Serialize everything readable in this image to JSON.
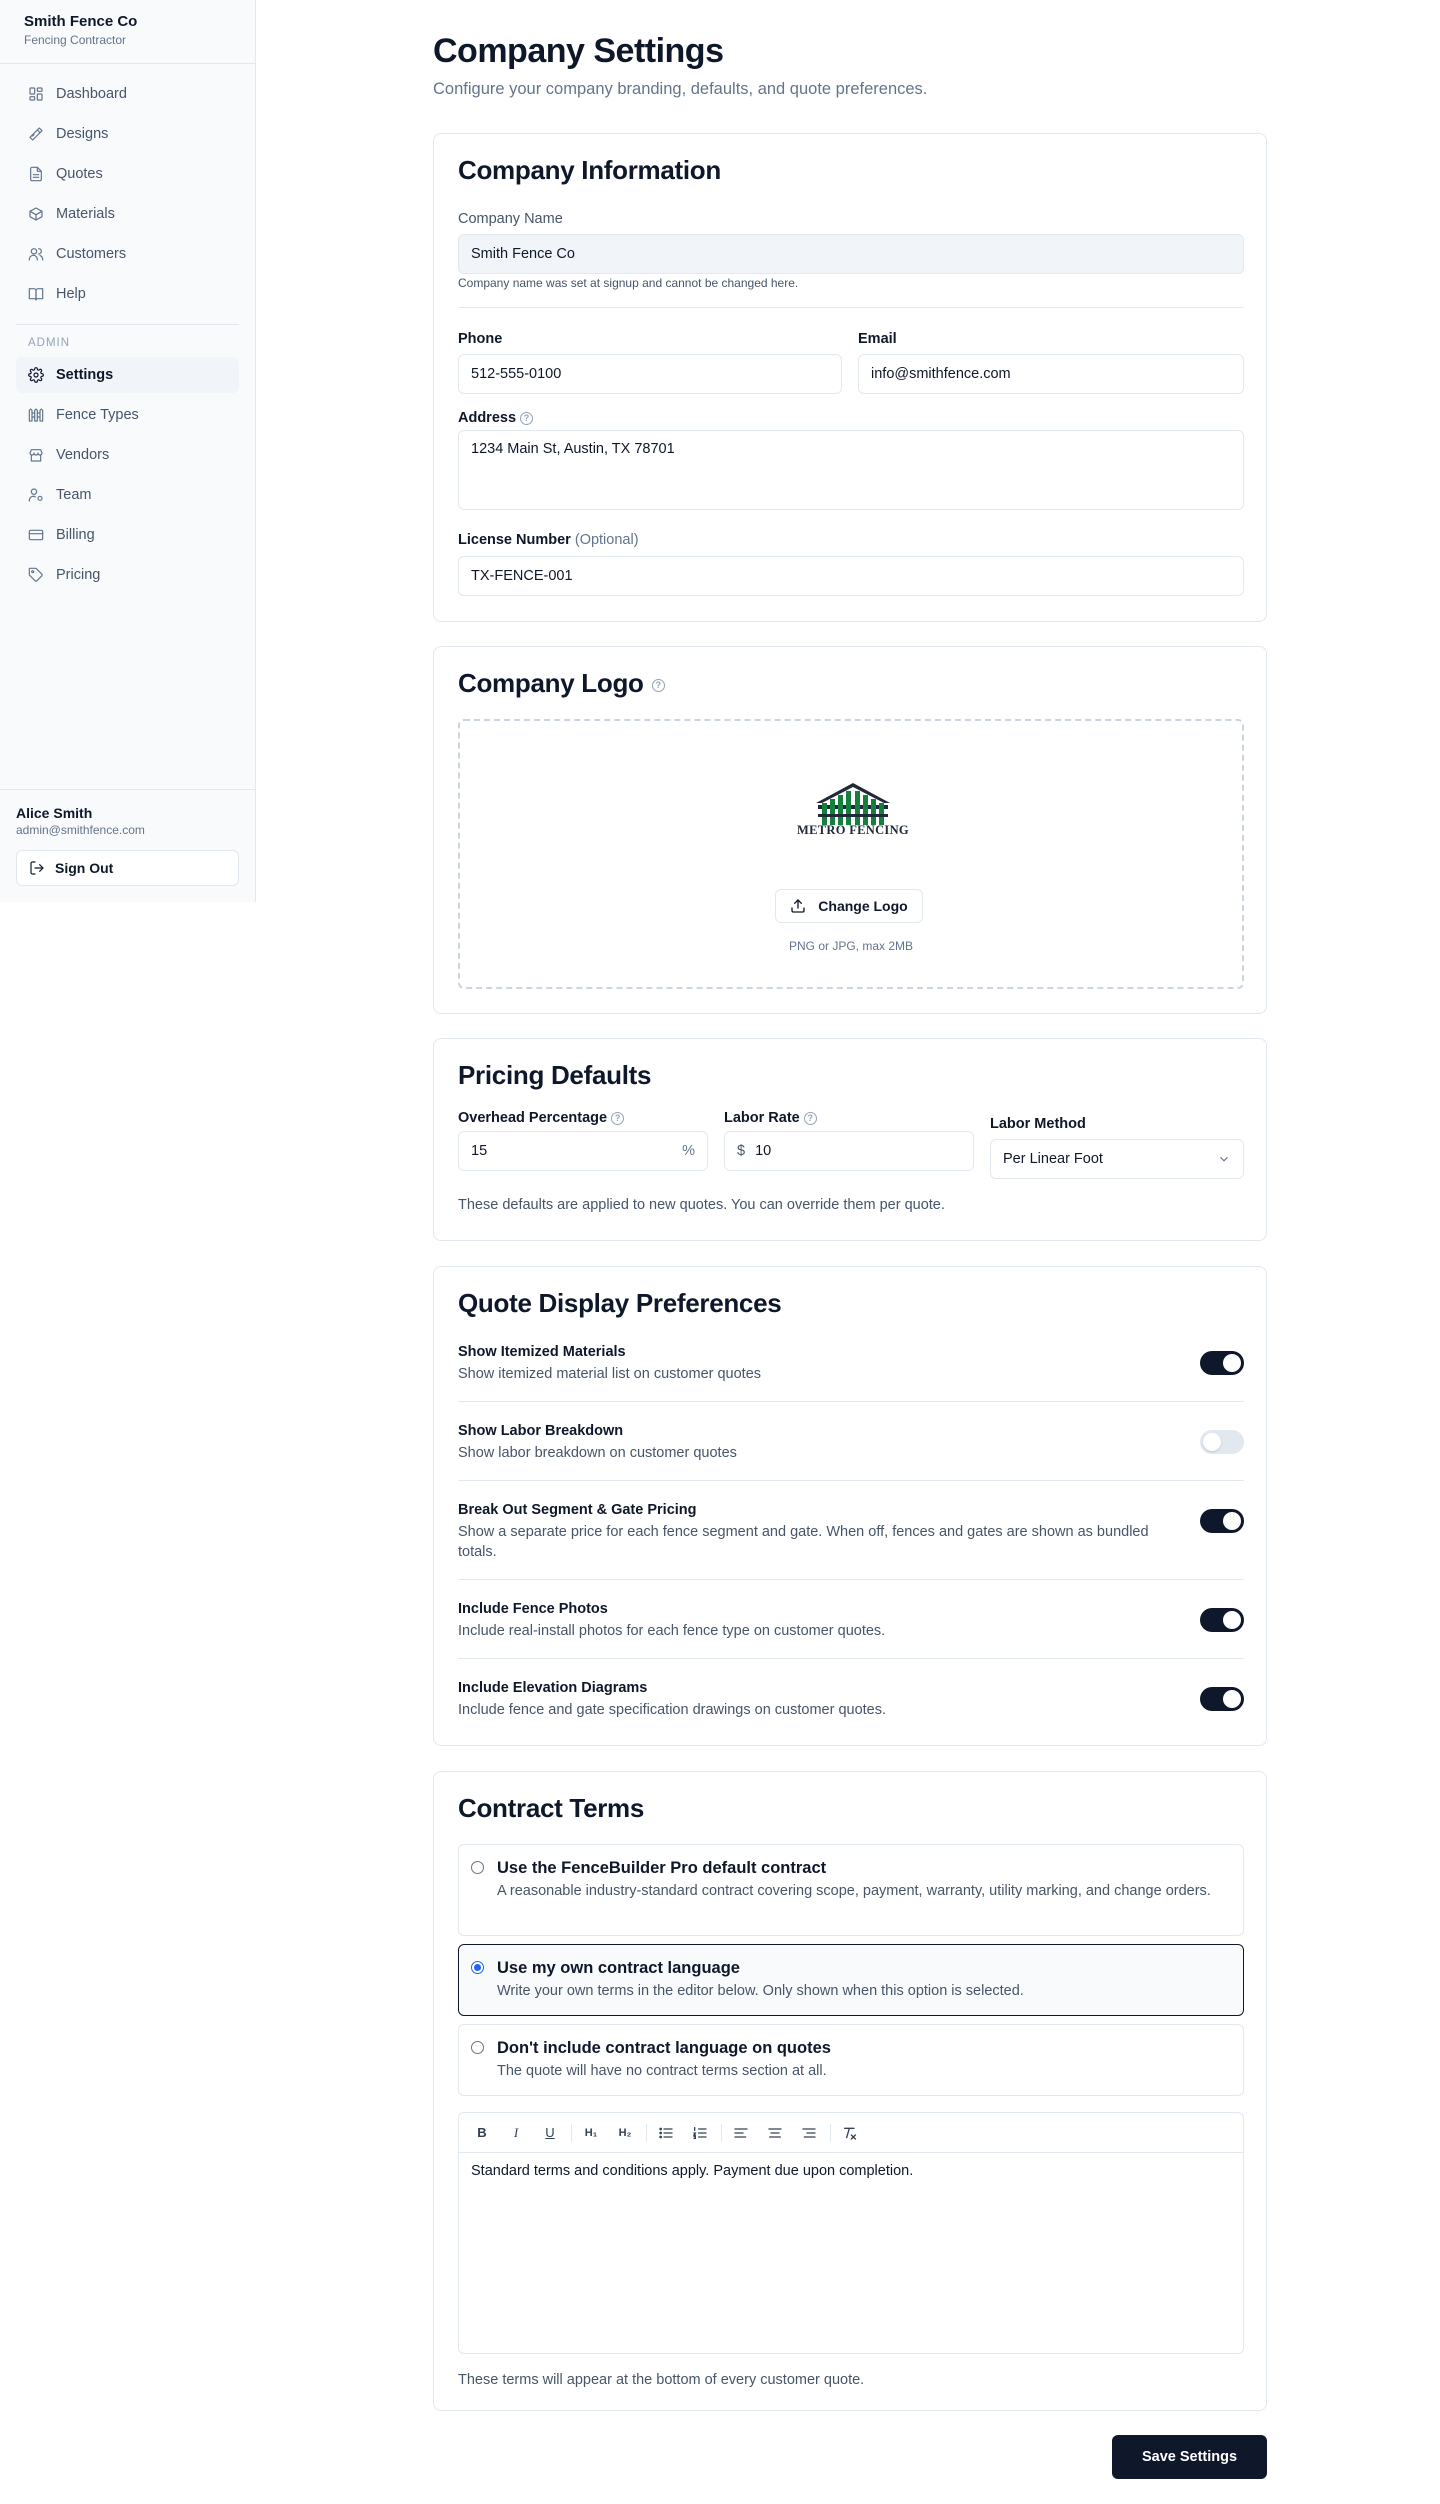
{
  "sidebar": {
    "company_name": "Smith Fence Co",
    "company_type": "Fencing Contractor",
    "items": [
      {
        "label": "Dashboard",
        "icon": "grid-icon"
      },
      {
        "label": "Designs",
        "icon": "pencil-ruler-icon"
      },
      {
        "label": "Quotes",
        "icon": "file-text-icon"
      },
      {
        "label": "Materials",
        "icon": "package-icon"
      },
      {
        "label": "Customers",
        "icon": "users-icon"
      },
      {
        "label": "Help",
        "icon": "book-icon"
      }
    ],
    "admin_section_label": "ADMIN",
    "admin_items": [
      {
        "label": "Settings",
        "icon": "gear-icon",
        "active": true
      },
      {
        "label": "Fence Types",
        "icon": "fence-icon"
      },
      {
        "label": "Vendors",
        "icon": "store-icon"
      },
      {
        "label": "Team",
        "icon": "user-cog-icon"
      },
      {
        "label": "Billing",
        "icon": "credit-card-icon"
      },
      {
        "label": "Pricing",
        "icon": "tag-icon"
      }
    ],
    "user_name": "Alice Smith",
    "user_email": "admin@smithfence.com",
    "sign_out_label": "Sign Out"
  },
  "header": {
    "title": "Company Settings",
    "subtitle": "Configure your company branding, defaults, and quote preferences."
  },
  "company_info": {
    "title": "Company Information",
    "company_name_label": "Company Name",
    "company_name_value": "Smith Fence Co",
    "company_name_hint": "Company name was set at signup and cannot be changed here.",
    "phone_label": "Phone",
    "phone_value": "512-555-0100",
    "email_label": "Email",
    "email_value": "info@smithfence.com",
    "address_label": "Address",
    "address_value": "1234 Main St, Austin, TX 78701",
    "license_label": "License Number",
    "license_optional": "(Optional)",
    "license_value": "TX-FENCE-001"
  },
  "logo": {
    "title": "Company Logo",
    "logo_text": "METRO FENCING",
    "change_label": "Change Logo",
    "hint": "PNG or JPG, max 2MB"
  },
  "pricing": {
    "title": "Pricing Defaults",
    "overhead_label": "Overhead Percentage",
    "overhead_value": "15",
    "overhead_unit": "%",
    "labor_rate_label": "Labor Rate",
    "labor_rate_prefix": "$",
    "labor_rate_value": "10",
    "labor_method_label": "Labor Method",
    "labor_method_value": "Per Linear Foot",
    "hint": "These defaults are applied to new quotes. You can override them per quote."
  },
  "display": {
    "title": "Quote Display Preferences",
    "prefs": [
      {
        "title": "Show Itemized Materials",
        "desc": "Show itemized material list on customer quotes",
        "on": true
      },
      {
        "title": "Show Labor Breakdown",
        "desc": "Show labor breakdown on customer quotes",
        "on": false
      },
      {
        "title": "Break Out Segment & Gate Pricing",
        "desc": "Show a separate price for each fence segment and gate. When off, fences and gates are shown as bundled totals.",
        "on": true
      },
      {
        "title": "Include Fence Photos",
        "desc": "Include real-install photos for each fence type on customer quotes.",
        "on": true
      },
      {
        "title": "Include Elevation Diagrams",
        "desc": "Include fence and gate specification drawings on customer quotes.",
        "on": true
      }
    ]
  },
  "contract": {
    "title": "Contract Terms",
    "options": [
      {
        "title": "Use the FenceBuilder Pro default contract",
        "desc": "A reasonable industry-standard contract covering scope, payment, warranty, utility marking, and change orders.",
        "selected": false
      },
      {
        "title": "Use my own contract language",
        "desc": "Write your own terms in the editor below. Only shown when this option is selected.",
        "selected": true
      },
      {
        "title": "Don't include contract language on quotes",
        "desc": "The quote will have no contract terms section at all.",
        "selected": false
      }
    ],
    "toolbar": {
      "bold": "B",
      "italic": "I",
      "underline": "U",
      "h1": "H₁",
      "h2": "H₂"
    },
    "editor_text": "Standard terms and conditions apply. Payment due upon completion.",
    "hint": "These terms will appear at the bottom of every customer quote."
  },
  "save_label": "Save Settings"
}
